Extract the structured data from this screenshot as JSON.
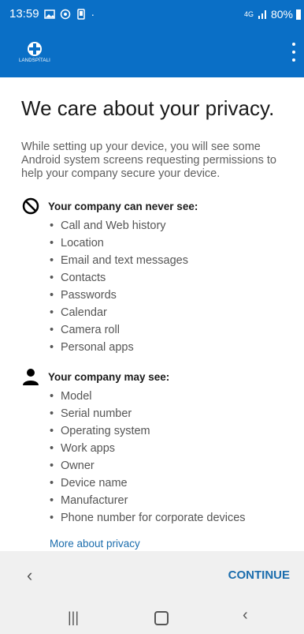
{
  "status_bar": {
    "time": "13:59",
    "network": "4G",
    "battery": "80%"
  },
  "app_bar": {
    "logo_text": "LANDSPÍTALI"
  },
  "main": {
    "title": "We care about your privacy.",
    "intro": "While setting up your device, you will see some Android system screens requesting permissions to help your company secure your device.",
    "never_see": {
      "title": "Your company can never see:",
      "items": [
        "Call and Web history",
        "Location",
        "Email and text messages",
        "Contacts",
        "Passwords",
        "Calendar",
        "Camera roll",
        "Personal apps"
      ]
    },
    "may_see": {
      "title": "Your company may see:",
      "items": [
        "Model",
        "Serial number",
        "Operating system",
        "Work apps",
        "Owner",
        "Device name",
        "Manufacturer",
        "Phone number for corporate devices"
      ]
    },
    "more_link": "More about privacy"
  },
  "footer": {
    "continue_label": "CONTINUE"
  },
  "colors": {
    "brand": "#0a6fc6",
    "link": "#1b6dad"
  }
}
